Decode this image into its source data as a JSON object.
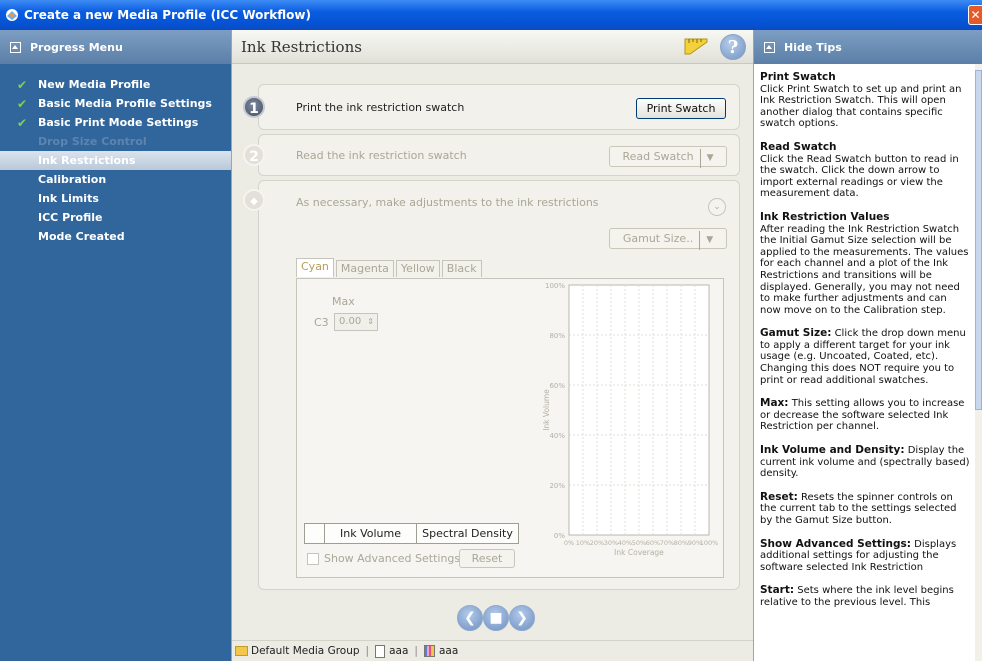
{
  "window": {
    "title": "Create a new Media Profile (ICC Workflow)",
    "close_glyph": "✕"
  },
  "left_panel": {
    "header": "Progress Menu",
    "items": [
      {
        "label": "New Media Profile",
        "state": "done"
      },
      {
        "label": "Basic Media Profile Settings",
        "state": "done"
      },
      {
        "label": "Basic Print Mode Settings",
        "state": "done"
      },
      {
        "label": "Drop Size Control",
        "state": "disabled"
      },
      {
        "label": "Ink Restrictions",
        "state": "active"
      },
      {
        "label": "Calibration",
        "state": "pending"
      },
      {
        "label": "Ink Limits",
        "state": "pending"
      },
      {
        "label": "ICC Profile",
        "state": "pending"
      },
      {
        "label": "Mode Created",
        "state": "pending"
      }
    ]
  },
  "main": {
    "title": "Ink Restrictions",
    "steps": [
      {
        "number": "1",
        "text": "Print the ink restriction swatch",
        "button": "Print Swatch"
      },
      {
        "number": "2",
        "text": "Read the ink restriction swatch",
        "button": "Read Swatch"
      },
      {
        "number": "",
        "text": "As necessary, make adjustments to the ink restrictions",
        "button": "Gamut Size.."
      }
    ],
    "tabs": [
      "Cyan",
      "Magenta",
      "Yellow",
      "Black"
    ],
    "max_label": "Max",
    "channel_label": "C3",
    "channel_value": "0.00",
    "toggle": {
      "left": "Ink Volume",
      "right": "Spectral Density"
    },
    "show_advanced_label": "Show Advanced Settings",
    "reset_label": "Reset"
  },
  "chart_data": {
    "type": "line",
    "title": "",
    "xlabel": "Ink Coverage",
    "ylabel": "Ink Volume",
    "x_ticks": [
      "0%",
      "10%",
      "20%",
      "30%",
      "40%",
      "50%",
      "60%",
      "70%",
      "80%",
      "90%",
      "100%"
    ],
    "y_ticks": [
      "0%",
      "20%",
      "40%",
      "60%",
      "80%",
      "100%"
    ],
    "xlim": [
      0,
      100
    ],
    "ylim": [
      0,
      100
    ],
    "grid": true,
    "series": []
  },
  "status_bar": {
    "group": "Default Media Group",
    "doc": "aaa",
    "mode": "aaa"
  },
  "right_panel": {
    "header": "Hide Tips",
    "tips": [
      {
        "title": "Print Swatch",
        "body": "Click Print Swatch to set up and print an Ink Restriction Swatch. This will open another dialog that contains specific swatch options."
      },
      {
        "title": "Read Swatch",
        "body": "Click the Read Swatch button to read in the swatch. Click the down arrow to import external readings or view the measurement data."
      },
      {
        "title": "Ink Restriction Values",
        "body": "After reading the Ink Restriction Swatch the Initial Gamut Size selection will be applied to the measurements. The values for each channel and a plot of the Ink Restrictions and transitions will be displayed. Generally, you may not need to make further adjustments and can now move on to the Calibration step."
      },
      {
        "title": "Gamut Size:",
        "body": "Click the drop down menu to apply a different target for your ink usage (e.g. Uncoated, Coated, etc). Changing this does NOT require you to print or read additional swatches."
      },
      {
        "title": "Max:",
        "body": "This setting allows you to increase or decrease the software selected Ink Restriction per channel."
      },
      {
        "title": "Ink Volume and Density:",
        "body": "Display the current ink volume and (spectrally based) density."
      },
      {
        "title": "Reset:",
        "body": "Resets the spinner controls on the current tab to the settings selected by the Gamut Size button."
      },
      {
        "title": "Show Advanced Settings:",
        "body": "Displays additional settings for adjusting the software selected Ink Restriction"
      },
      {
        "title": "Start:",
        "body": "Sets where the ink level begins relative to the previous level. This"
      }
    ]
  }
}
